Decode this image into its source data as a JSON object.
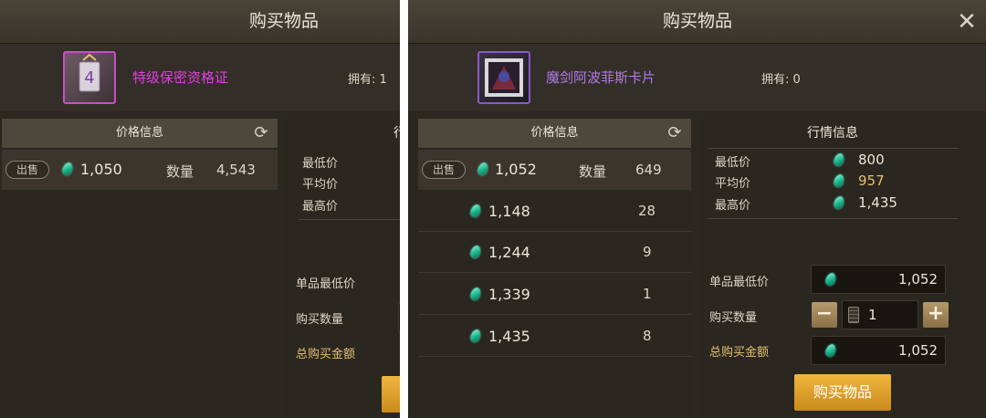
{
  "left": {
    "title": "购买物品",
    "item_name": "特级保密资格证",
    "item_icon_digit": "4",
    "owned": "拥有: 1",
    "price_header": "价格信息",
    "listing": {
      "sell_label": "出售",
      "price": "1,050",
      "qty_label": "数量",
      "qty": "4,543"
    },
    "market_header_partial": "行",
    "stat_labels": {
      "min": "最低价",
      "avg": "平均价",
      "max": "最高价"
    },
    "form": {
      "unit_min": "单品最低价",
      "buy_qty": "购买数量",
      "total": "总购买金额"
    }
  },
  "right": {
    "title": "购买物品",
    "close_icon": "close-icon",
    "item_name": "魔剑阿波菲斯卡片",
    "owned": "拥有: 0",
    "price_header": "价格信息",
    "listings": [
      {
        "sell_label": "出售",
        "price": "1,052",
        "qty_label": "数量",
        "qty": "649"
      },
      {
        "price": "1,148",
        "qty": "28"
      },
      {
        "price": "1,244",
        "qty": "9"
      },
      {
        "price": "1,339",
        "qty": "1"
      },
      {
        "price": "1,435",
        "qty": "8"
      }
    ],
    "market_header": "行情信息",
    "stats": {
      "min_label": "最低价",
      "min": "800",
      "avg_label": "平均价",
      "avg": "957",
      "max_label": "最高价",
      "max": "1,435"
    },
    "form": {
      "unit_min_label": "单品最低价",
      "unit_min": "1,052",
      "buy_qty_label": "购买数量",
      "buy_qty": "1",
      "minus": "−",
      "plus": "+",
      "total_label": "总购买金额",
      "total": "1,052"
    },
    "buy_button": "购买物品"
  },
  "colors": {
    "panel_bg": "#2b2721",
    "gold_button": "#e2a42e",
    "left_item_name": "#e040e0",
    "right_item_name": "#b07ae8",
    "avg_price": "#e6c070"
  }
}
